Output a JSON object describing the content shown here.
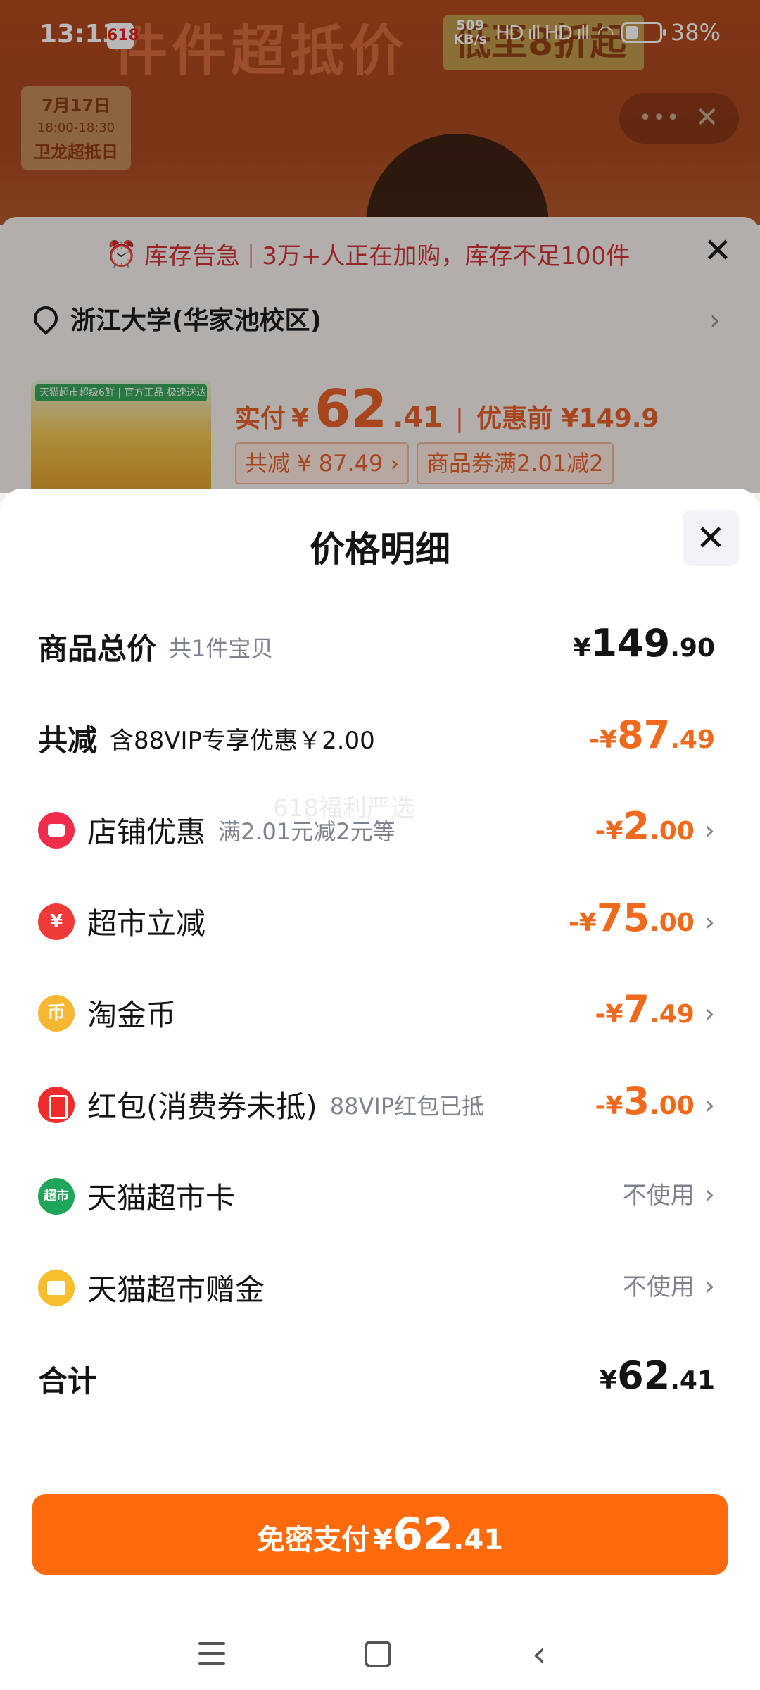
{
  "status_bar": {
    "time": "13:13",
    "app_badge": "618",
    "net_speed_value": "509",
    "net_speed_unit": "KB/s",
    "signal": "HD ıll HD ıll",
    "battery_percent": "38%",
    "battery_level": 0.38
  },
  "background": {
    "banner_text": "件件超抵价",
    "banner_badge": "低至8折起",
    "date_card": {
      "date": "7月17日",
      "time": "18:00-18:30",
      "event": "卫龙超抵日"
    },
    "capsule_dots": "•••",
    "capsule_close": "✕"
  },
  "order_card": {
    "alert_icon": "alarm-clock-icon",
    "alert_title": "库存告急",
    "alert_separator": "|",
    "alert_text": "3万+人正在加购，库存不足100件",
    "close": "✕",
    "address": "浙江大学(华家池校区)",
    "address_chevron": "›",
    "product_tag": "天猫超市超级6鲜 | 官方正品 极速送达",
    "pay_label": "实付",
    "pay_currency": "¥",
    "pay_int": "62",
    "pay_dec": ".41",
    "separator": "|",
    "orig_price": "优惠前 ¥149.9",
    "chip_total_discount": "共减 ¥ 87.49 ›",
    "chip_coupon": "商品券满2.01减2"
  },
  "sheet": {
    "title": "价格明细",
    "close": "✕",
    "watermark": "618福利严选",
    "rows": [
      {
        "label": "商品总价",
        "sub": "共1件宝贝",
        "cur": "¥",
        "int": "149",
        "dec": ".90"
      },
      {
        "label": "共减",
        "sub": "含88VIP专享优惠￥2.00",
        "cur": "-¥",
        "int": "87",
        "dec": ".49"
      },
      {
        "label": "店铺优惠",
        "sub": "满2.01元减2元等",
        "cur": "-¥",
        "int": "2",
        "dec": ".00",
        "icon": "store-icon"
      },
      {
        "label": "超市立减",
        "sub": "",
        "cur": "-¥",
        "int": "75",
        "dec": ".00",
        "icon": "yen-icon",
        "icon_text": "¥"
      },
      {
        "label": "淘金币",
        "sub": "",
        "cur": "-¥",
        "int": "7",
        "dec": ".49",
        "icon": "coin-icon",
        "icon_text": "币"
      },
      {
        "label": "红包(消费券未抵)",
        "sub": "88VIP红包已抵",
        "cur": "-¥",
        "int": "3",
        "dec": ".00",
        "icon": "red-packet-icon"
      },
      {
        "label": "天猫超市卡",
        "value": "不使用",
        "icon": "supermarket-card-icon",
        "icon_text": "超市"
      },
      {
        "label": "天猫超市赠金",
        "value": "不使用",
        "icon": "gift-money-icon"
      },
      {
        "label": "合计",
        "cur": "¥",
        "int": "62",
        "dec": ".41"
      }
    ],
    "chevron": "›"
  },
  "pay_button": {
    "label": "免密支付",
    "cur": "¥",
    "int": "62",
    "dec": ".41"
  },
  "colors": {
    "accent_orange": "#ff6a0c",
    "discount_orange": "#f06a1d",
    "alert_red": "#d4343a"
  }
}
